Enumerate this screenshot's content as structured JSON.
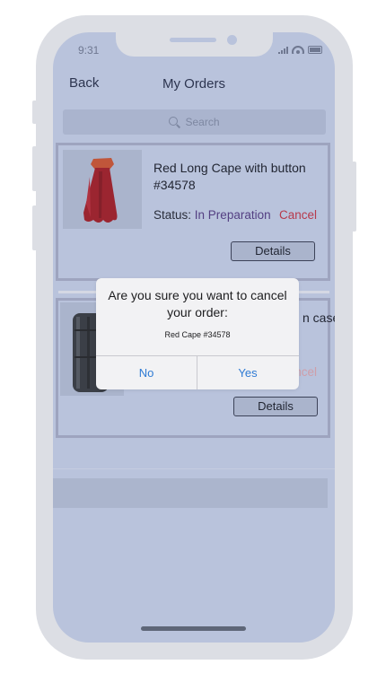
{
  "status_bar": {
    "time": "9:31"
  },
  "header": {
    "back_label": "Back",
    "title": "My Orders"
  },
  "search": {
    "placeholder": "Search"
  },
  "orders": [
    {
      "title": "Red Long Cape with button #34578",
      "status_label": "Status:",
      "status_value": "In Preparation",
      "cancel_label": "Cancel",
      "details_label": "Details"
    },
    {
      "title_visible": "n case",
      "cancel_label_partial": "ncel",
      "details_label": "Details"
    }
  ],
  "dialog": {
    "title": "Are you sure you want to cancel your order:",
    "subtitle": "Red Cape #34578",
    "no_label": "No",
    "yes_label": "Yes"
  },
  "colors": {
    "screen_bg": "#b9c3dc",
    "frame": "#dcdee4",
    "cancel": "#b73a4c",
    "status_value": "#533f82",
    "dialog_button": "#2f7bd4"
  }
}
